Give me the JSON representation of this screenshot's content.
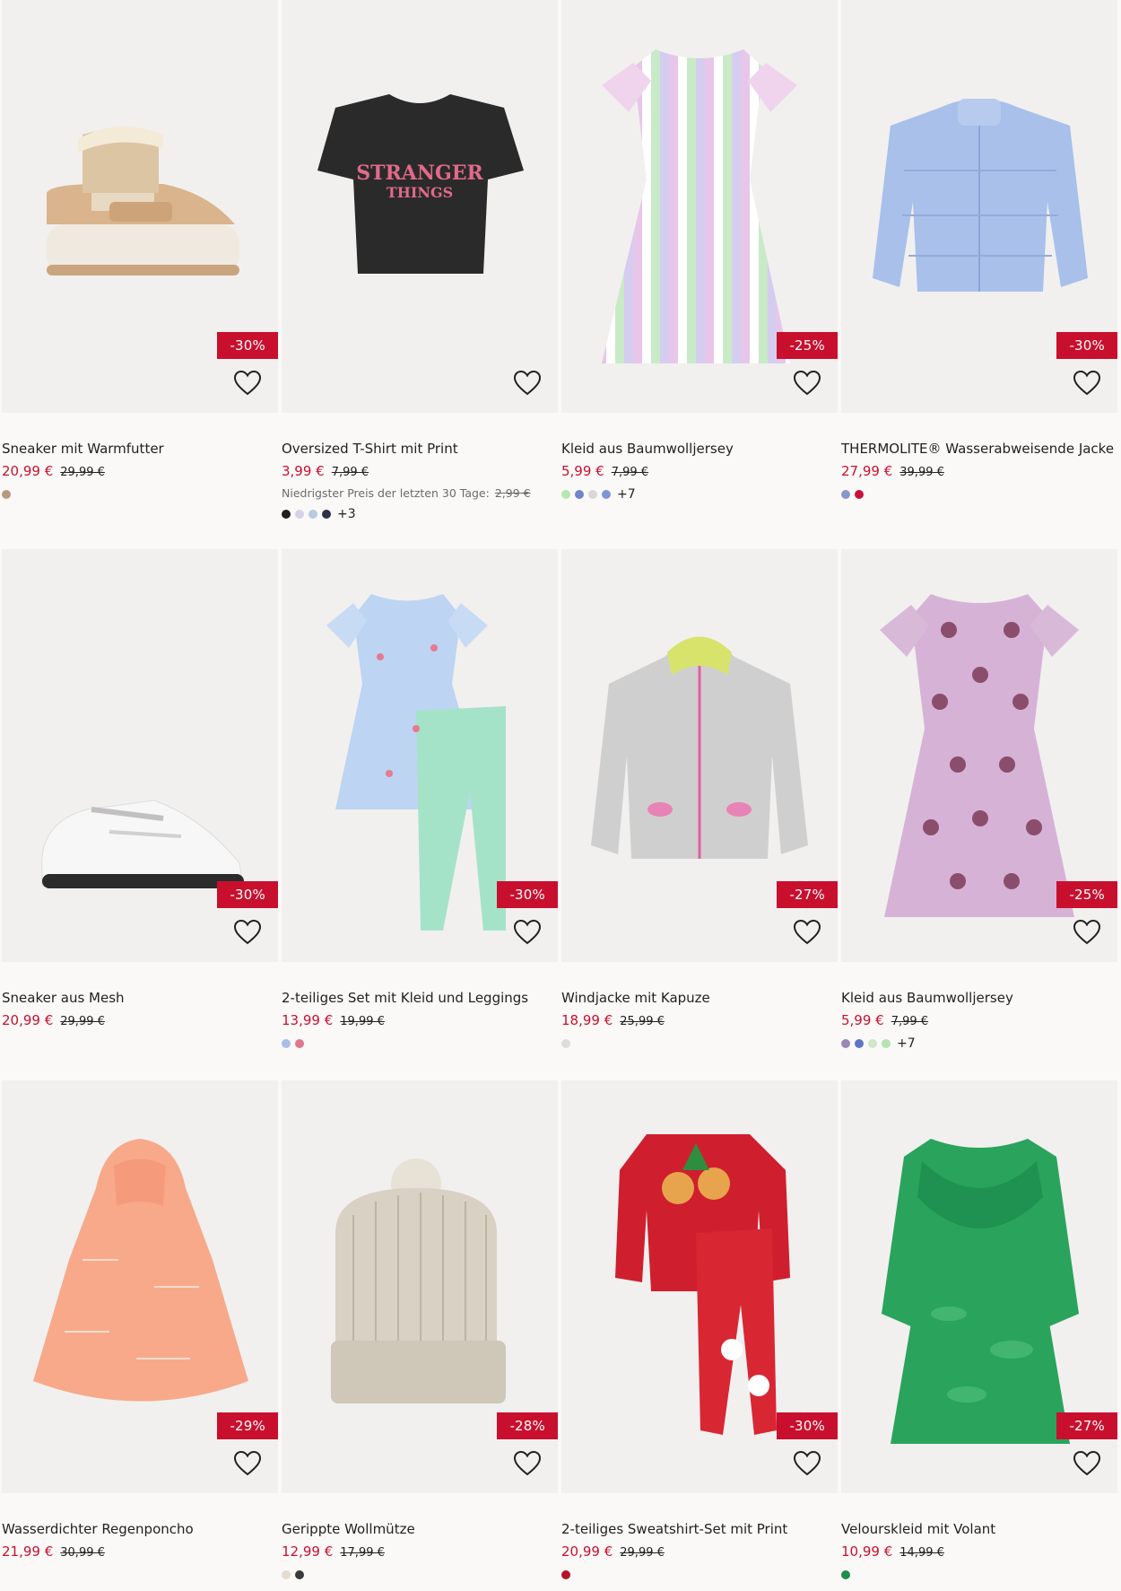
{
  "products": [
    {
      "title": "Sneaker mit Warmfutter",
      "price": "20,99 €",
      "old_price": "29,99 €",
      "discount": "-30%",
      "lowest_label": "",
      "lowest_price": "",
      "swatches": [
        "#b79a7e"
      ],
      "more": "",
      "image": "sneaker-boot",
      "accent": "#d9b48c"
    },
    {
      "title": "Oversized T-Shirt mit Print",
      "price": "3,99 €",
      "old_price": "7,99 €",
      "discount": "",
      "lowest_label": "Niedrigster Preis der letzten 30 Tage:",
      "lowest_price": "2,99 €",
      "swatches": [
        "#1e1e1e",
        "#d6d2e6",
        "#b9c9e0",
        "#2c3247"
      ],
      "more": "+3",
      "image": "tshirt",
      "accent": "#2a2a2a"
    },
    {
      "title": "Kleid aus Baumwolljersey",
      "price": "5,99 €",
      "old_price": "7,99 €",
      "discount": "-25%",
      "lowest_label": "",
      "lowest_price": "",
      "swatches": [
        "#b7e6b0",
        "#6f86c9",
        "#d8d8d8",
        "#7e95d6"
      ],
      "more": "+7",
      "image": "striped-dress",
      "accent": "#e9c7e8"
    },
    {
      "title": "THERMOLITE® Wasserabweisende Jacke",
      "price": "27,99 €",
      "old_price": "39,99 €",
      "discount": "-30%",
      "lowest_label": "",
      "lowest_price": "",
      "swatches": [
        "#8797c9",
        "#c8103b"
      ],
      "more": "",
      "image": "puffer-jacket",
      "accent": "#a8c0ea"
    },
    {
      "title": "Sneaker aus Mesh",
      "price": "20,99 €",
      "old_price": "29,99 €",
      "discount": "-30%",
      "lowest_label": "",
      "lowest_price": "",
      "swatches": [],
      "more": "",
      "image": "mesh-sneaker",
      "accent": "#f2f2f2"
    },
    {
      "title": "2-teiliges Set mit Kleid und Leggings",
      "price": "13,99 €",
      "old_price": "19,99 €",
      "discount": "-30%",
      "lowest_label": "",
      "lowest_price": "",
      "swatches": [
        "#a9bde6",
        "#e0768f"
      ],
      "more": "",
      "image": "dress-leggings",
      "accent": "#bdd4f2"
    },
    {
      "title": "Windjacke mit Kapuze",
      "price": "18,99 €",
      "old_price": "25,99 €",
      "discount": "-27%",
      "lowest_label": "",
      "lowest_price": "",
      "swatches": [
        "#dcdcdc"
      ],
      "more": "",
      "image": "windbreaker",
      "accent": "#cfcfcf"
    },
    {
      "title": "Kleid aus Baumwolljersey",
      "price": "5,99 €",
      "old_price": "7,99 €",
      "discount": "-25%",
      "lowest_label": "",
      "lowest_price": "",
      "swatches": [
        "#9a87b6",
        "#5f74c4",
        "#cfe6c9",
        "#b7e3b0"
      ],
      "more": "+7",
      "image": "polka-dress",
      "accent": "#d6b3d6"
    },
    {
      "title": "Wasserdichter Regenponcho",
      "price": "21,99 €",
      "old_price": "30,99 €",
      "discount": "-29%",
      "lowest_label": "",
      "lowest_price": "",
      "swatches": [],
      "more": "",
      "image": "poncho",
      "accent": "#f7a98a"
    },
    {
      "title": "Gerippte Wollmütze",
      "price": "12,99 €",
      "old_price": "17,99 €",
      "discount": "-28%",
      "lowest_label": "",
      "lowest_price": "",
      "swatches": [
        "#e3dccd",
        "#3a3a3a"
      ],
      "more": "",
      "image": "beanie",
      "accent": "#d8d1c4"
    },
    {
      "title": "2-teiliges Sweatshirt-Set mit Print",
      "price": "20,99 €",
      "old_price": "29,99 €",
      "discount": "-30%",
      "lowest_label": "",
      "lowest_price": "",
      "swatches": [
        "#b3122b"
      ],
      "more": "",
      "image": "sweat-set",
      "accent": "#cf1f2e"
    },
    {
      "title": "Velourskleid mit Volant",
      "price": "10,99 €",
      "old_price": "14,99 €",
      "discount": "-27%",
      "lowest_label": "",
      "lowest_price": "",
      "swatches": [
        "#1e8c4a"
      ],
      "more": "",
      "image": "velour-dress",
      "accent": "#2aa35c"
    }
  ],
  "colors": {
    "discount_bg": "#c8102e",
    "sale_price": "#c8102e",
    "background": "#faf9f8",
    "image_bg": "#f1f0ef"
  }
}
